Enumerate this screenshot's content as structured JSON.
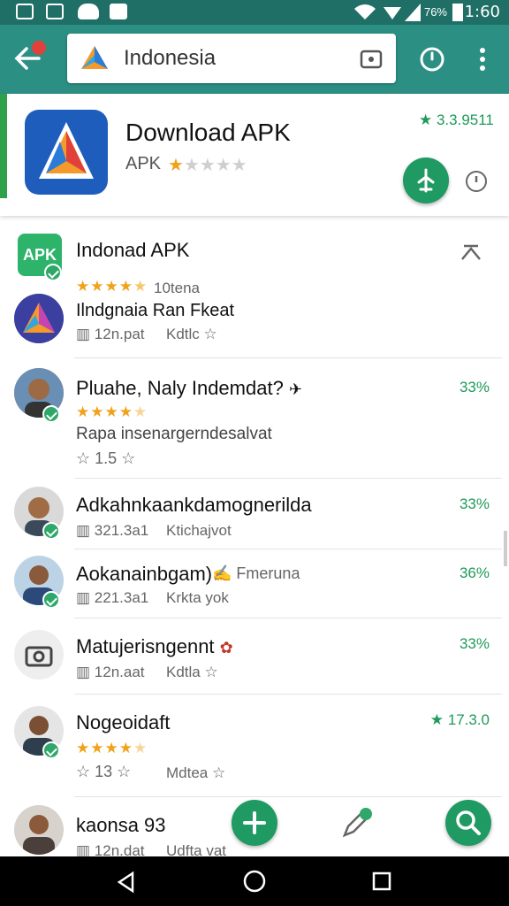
{
  "status_bar": {
    "percent": "76%",
    "time": "1:60"
  },
  "search": {
    "query": "Indonesia"
  },
  "top_card": {
    "title": "Download APK",
    "subtitle": "APK",
    "rating_count": "3.3.9511",
    "rating_stars": 1.5
  },
  "list": [
    {
      "title": "Indonad APK",
      "rating_text": "10tena",
      "stars": 4.5
    },
    {
      "title": "Ilndgnaia Ran Fkeat",
      "meta_left": "12n.pat",
      "meta_right": "Kdtlc"
    },
    {
      "title": "Pluahe, Naly Indemdat?",
      "stars": 4,
      "subtitle": "Rapa insenargerndesalvat",
      "rating": "1.5",
      "percent": "33%"
    },
    {
      "title": "Adkahnkaankdamognerilda",
      "meta_left": "321.3a1",
      "meta_right": "Ktichajvot",
      "percent": "33%"
    },
    {
      "title": "Aokanainbgam)",
      "tag": "Fmeruna",
      "meta_left": "221.3a1",
      "meta_right": "Krkta yok",
      "percent": "36%"
    },
    {
      "title": "Matujerisngennt",
      "meta_left": "12n.aat",
      "meta_right": "Kdtla",
      "percent": "33%"
    },
    {
      "title": "Nogeoidaft",
      "stars": 4,
      "rating": "13",
      "meta_right": "Mdtea",
      "percent": "17.3.0"
    },
    {
      "title": "kaonsa 93",
      "meta_left": "12n.dat",
      "meta_right": "Udfta vat"
    }
  ],
  "colors": {
    "primary": "#2c8f83",
    "accent": "#1f9a62",
    "star": "#f0a21b"
  }
}
